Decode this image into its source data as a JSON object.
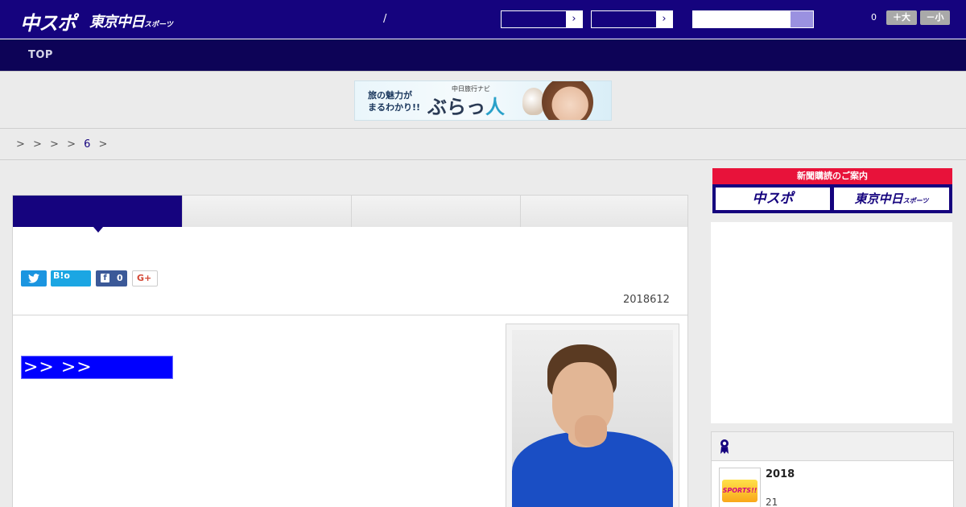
{
  "header": {
    "logo_main": "中スポ",
    "logo_tokyo": "東京中日",
    "logo_tokyo_suffix": "スポーツ",
    "divider": "/",
    "select_arrow": "›",
    "search_placeholder": "",
    "count": "0",
    "font_plus": "＋大",
    "font_minus": "－小"
  },
  "nav": {
    "top": "TOP"
  },
  "banner": {
    "line1": "旅の魅力が",
    "line2": "まるわかり!!",
    "small": "中日旅行ナビ",
    "name_a": "ぶらっ",
    "name_b": "人"
  },
  "breadcrumb": {
    "text": "> > > >",
    "link": "6",
    "tail": ">"
  },
  "share": {
    "hatena_label": "B!o",
    "facebook_letter": "f",
    "facebook_count": "0",
    "googleplus_label": "G+"
  },
  "article": {
    "date": "2018612",
    "more_link": ">> >>"
  },
  "sidebar": {
    "subscribe_title": "新聞購読のご案内",
    "subscribe_chuspo": "中スポ",
    "subscribe_tokyo": "東京中日",
    "subscribe_tokyo_suffix": "スポーツ",
    "ranking": {
      "thumb_label": "SPORTS!!",
      "title": "2018",
      "subtitle": "21"
    }
  },
  "colors": {
    "header_bg": "#15037e",
    "nav_bg": "#0d0357",
    "accent_red": "#e8123a",
    "link_blue": "#0000ff"
  }
}
